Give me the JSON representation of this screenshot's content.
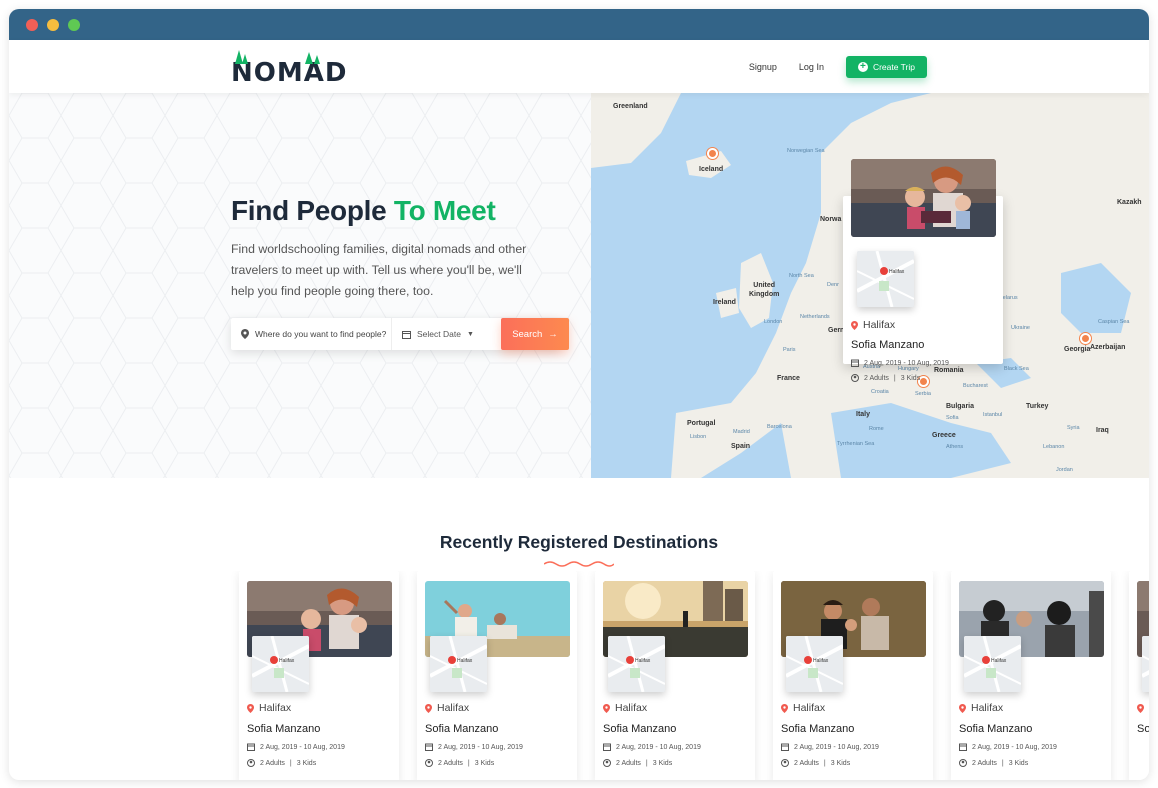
{
  "brand": {
    "logo_text": "NOMAD"
  },
  "nav": {
    "signup": "Signup",
    "login": "Log In",
    "create_trip": "Create Trip"
  },
  "colors": {
    "titlebar": "#336488",
    "accent_green": "#12b364",
    "search_orange": "#fb6f5a",
    "pin": "#f2844d"
  },
  "hero": {
    "title_part1": "Find People",
    "title_part2": "To Meet",
    "description": "Find worldschooling families, digital nomads and other travelers to meet up with. Tell us where you'll be, we'll help you find people going there, too.",
    "search_placeholder": "Where do you want to find people?",
    "date_label": "Select Date",
    "search_button": "Search"
  },
  "map": {
    "labels": {
      "greenland": "Greenland",
      "iceland": "Iceland",
      "norway": "Norwa",
      "ireland": "Ireland",
      "uk": "United\nKingdom",
      "france": "France",
      "portugal": "Portugal",
      "spain": "Spain",
      "italy": "Italy",
      "romania": "Romania",
      "bulgaria": "Bulgaria",
      "greece": "Greece",
      "turkey": "Turkey",
      "georgia": "Georgia",
      "azerbaijan": "Azerbaijan",
      "iraq": "Iraq",
      "kazakh": "Kazakh",
      "serbia": "Serbia",
      "london": "London",
      "paris": "Paris",
      "netherlands": "Netherlands",
      "madrid": "Madrid",
      "ukraine": "Ukraine",
      "syria": "Syria",
      "belarus": "Belarus",
      "germany": "Gern",
      "denmark": "Denr",
      "austria": "Austria",
      "croatia": "Croatia",
      "lebanon": "Lebanon",
      "jordan": "Jordan",
      "lisbon": "Lisbon",
      "barcelona": "Barcelona",
      "rome": "Rome",
      "istanbul": "Istanbul",
      "athens": "Athens",
      "sofia_city": "Sofia",
      "bucharest": "Bucharest",
      "hungary": "Hungary"
    },
    "seas": {
      "norwegian": "Norwegian Sea",
      "north": "North Sea",
      "black": "Black Sea",
      "caspian": "Caspian Sea",
      "tyrrhenian": "Tyrrhenian Sea"
    },
    "popup": {
      "city": "Halifax",
      "name": "Sofia Manzano",
      "dates": "2 Aug, 2019 - 10 Aug, 2019",
      "adults": "2 Adults",
      "kids": "3 Kids",
      "minimap_label": "Halifax"
    }
  },
  "destinations": {
    "title": "Recently Registered Destinations",
    "cards": [
      {
        "city": "Halifax",
        "name": "Sofia Manzano",
        "dates": "2 Aug, 2019 - 10 Aug, 2019",
        "adults": "2 Adults",
        "kids": "3 Kids",
        "minimap_label": "Halifax"
      },
      {
        "city": "Halifax",
        "name": "Sofia Manzano",
        "dates": "2 Aug, 2019 - 10 Aug, 2019",
        "adults": "2 Adults",
        "kids": "3 Kids",
        "minimap_label": "Halifax"
      },
      {
        "city": "Halifax",
        "name": "Sofia Manzano",
        "dates": "2 Aug, 2019 - 10 Aug, 2019",
        "adults": "2 Adults",
        "kids": "3 Kids",
        "minimap_label": "Halifax"
      },
      {
        "city": "Halifax",
        "name": "Sofia Manzano",
        "dates": "2 Aug, 2019 - 10 Aug, 2019",
        "adults": "2 Adults",
        "kids": "3 Kids",
        "minimap_label": "Halifax"
      },
      {
        "city": "Halifax",
        "name": "Sofia Manzano",
        "dates": "2 Aug, 2019 - 10 Aug, 2019",
        "adults": "2 Adults",
        "kids": "3 Kids",
        "minimap_label": "Halifax"
      },
      {
        "city": "H",
        "name": "Sofi",
        "dates": "",
        "adults": "",
        "kids": "",
        "minimap_label": ""
      }
    ]
  }
}
